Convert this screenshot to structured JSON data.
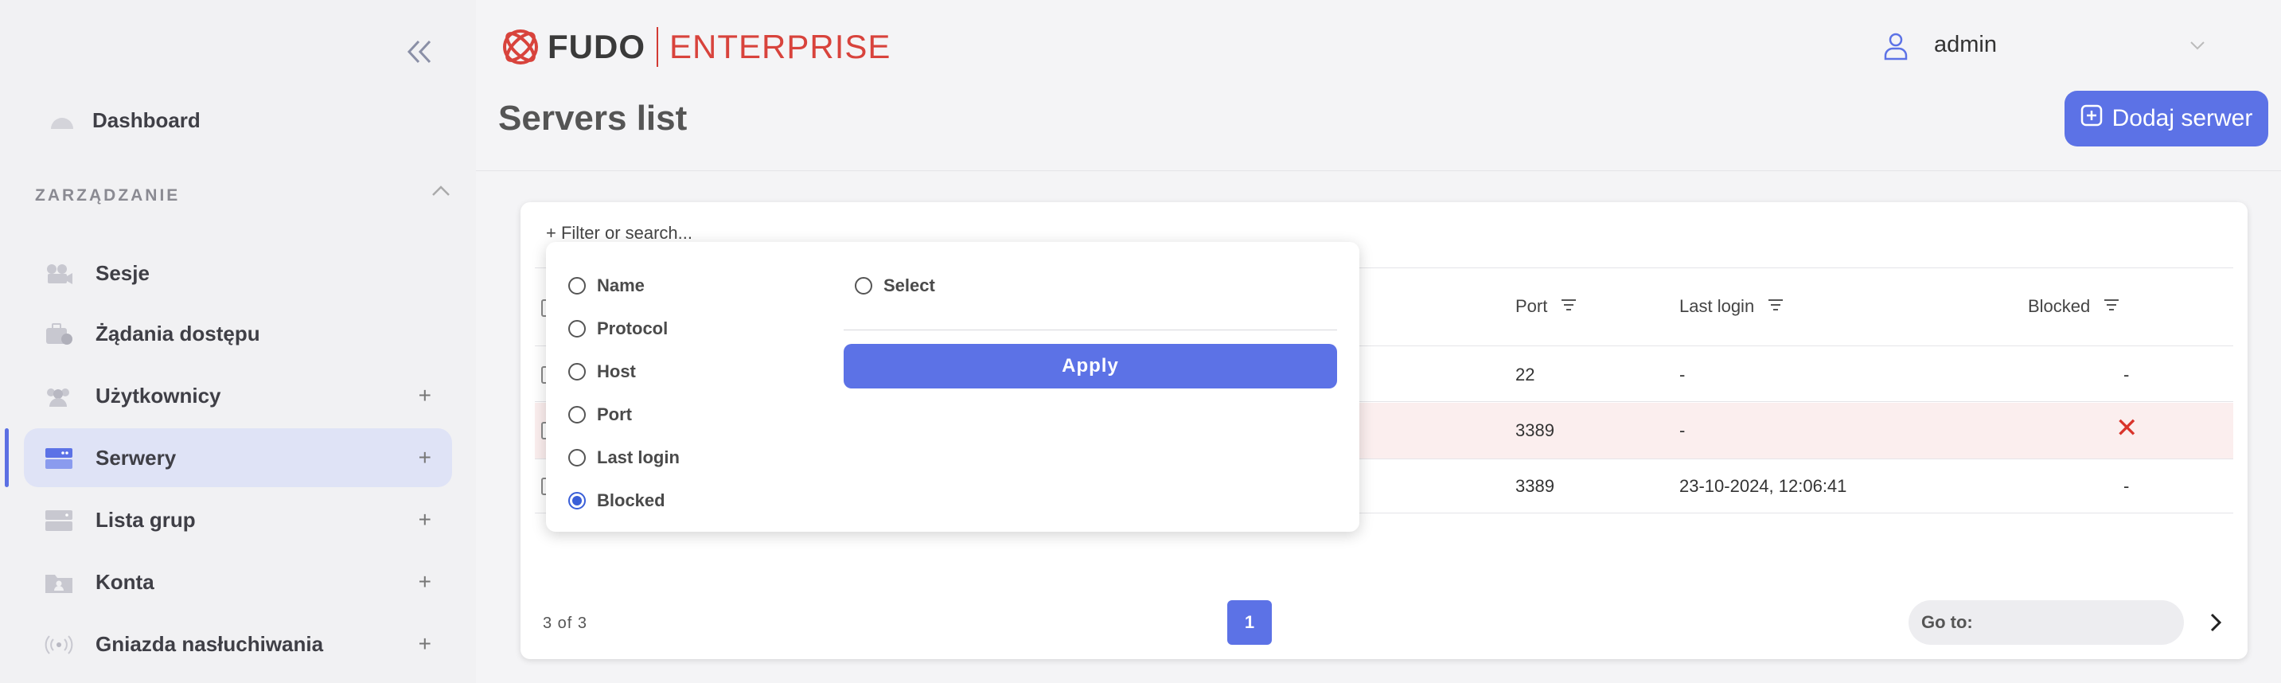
{
  "sidebar": {
    "dashboard": "Dashboard",
    "section": "ZARZĄDZANIE",
    "items": [
      {
        "label": "Sesje",
        "plus": ""
      },
      {
        "label": "Żądania dostępu",
        "plus": ""
      },
      {
        "label": "Użytkownicy",
        "plus": "+"
      },
      {
        "label": "Serwery",
        "plus": "+"
      },
      {
        "label": "Lista grup",
        "plus": "+"
      },
      {
        "label": "Konta",
        "plus": "+"
      },
      {
        "label": "Gniazda nasłuchiwania",
        "plus": "+"
      }
    ]
  },
  "header": {
    "logo_main": "FUDO",
    "logo_edition": "ENTERPRISE",
    "user": "admin"
  },
  "page": {
    "title": "Servers list",
    "add_button": "Dodaj serwer"
  },
  "table": {
    "filter_placeholder": "+ Filter or search...",
    "columns": {
      "port": "Port",
      "last_login": "Last login",
      "blocked": "Blocked"
    },
    "rows": [
      {
        "port": "22",
        "last_login": "-",
        "blocked": "-"
      },
      {
        "port": "3389",
        "last_login": "-",
        "blocked": "✕"
      },
      {
        "port": "3389",
        "last_login": "23-10-2024, 12:06:41",
        "blocked": "-"
      }
    ],
    "pager_info": "3 of 3",
    "page": "1",
    "goto_label": "Go to:"
  },
  "filter_menu": {
    "fields": [
      "Name",
      "Protocol",
      "Host",
      "Port",
      "Last login",
      "Blocked"
    ],
    "selected": "Blocked",
    "value_option": "Select",
    "apply": "Apply"
  },
  "colors": {
    "accent": "#5c72e6",
    "brand_red": "#d8433c",
    "blocked_red": "#d9342b"
  }
}
